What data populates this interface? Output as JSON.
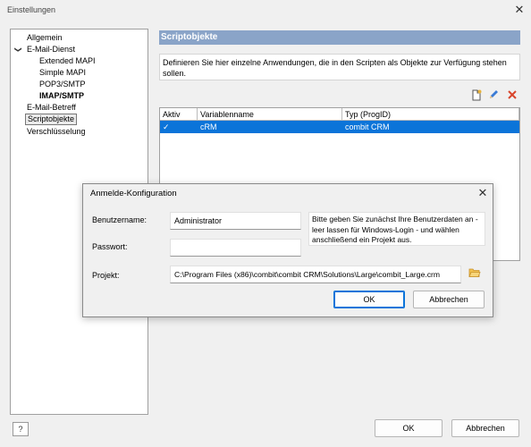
{
  "window": {
    "title": "Einstellungen",
    "close_glyph": "✕"
  },
  "tree": {
    "items": [
      {
        "label": "Allgemein"
      },
      {
        "label": "E-Mail-Dienst",
        "expanded": true
      },
      {
        "label": "Extended MAPI"
      },
      {
        "label": "Simple MAPI"
      },
      {
        "label": "POP3/SMTP"
      },
      {
        "label": "IMAP/SMTP",
        "bold": true
      },
      {
        "label": "E-Mail-Betreff"
      },
      {
        "label": "Scriptobjekte",
        "selected": true
      },
      {
        "label": "Verschlüsselung"
      }
    ],
    "chevron_glyph": "❯"
  },
  "panel": {
    "title": "Scriptobjekte",
    "description": "Definieren Sie hier einzelne Anwendungen, die in den Scripten als Objekte zur Verfügung stehen sollen.",
    "toolbar": {
      "new_icon": "new-document-icon",
      "edit_icon": "pencil-icon",
      "delete_icon": "delete-x-icon"
    },
    "grid": {
      "columns": [
        "Aktiv",
        "Variablenname",
        "Typ (ProgID)"
      ],
      "rows": [
        {
          "active_glyph": "✓",
          "name": "cRM",
          "type": "combit CRM"
        }
      ]
    }
  },
  "dialog": {
    "title": "Anmelde-Konfiguration",
    "close_glyph": "✕",
    "username_label": "Benutzername:",
    "username_value": "Administrator",
    "password_label": "Passwort:",
    "password_value": "",
    "project_label": "Projekt:",
    "project_value": "C:\\Program Files (x86)\\combit\\combit CRM\\Solutions\\Large\\combit_Large.crm",
    "hint": "Bitte geben Sie zunächst Ihre Benutzerdaten an - leer lassen für Windows-Login - und wählen anschließend ein Projekt aus.",
    "ok_label": "OK",
    "cancel_label": "Abbrechen"
  },
  "footer": {
    "help_glyph": "?",
    "ok_label": "OK",
    "cancel_label": "Abbrechen"
  },
  "colors": {
    "panel_header": "#8aa4c8",
    "selection": "#0b74d9",
    "delete": "#d9452b"
  }
}
